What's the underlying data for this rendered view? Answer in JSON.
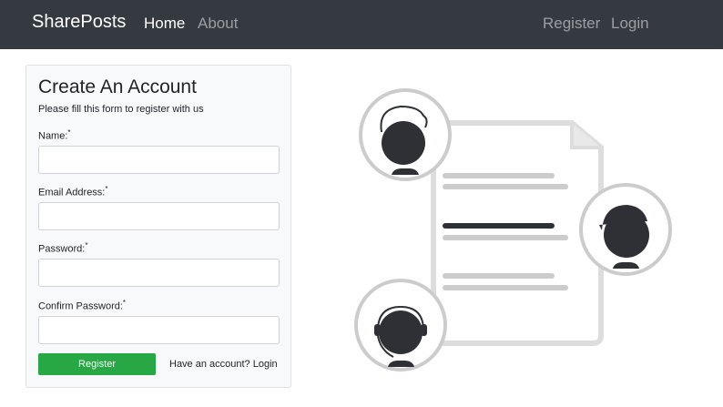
{
  "navbar": {
    "brand": "SharePosts",
    "links": [
      {
        "label": "Home",
        "active": true
      },
      {
        "label": "About",
        "active": false
      },
      {
        "label": "Register",
        "active": false
      },
      {
        "label": "Login",
        "active": false
      }
    ]
  },
  "form": {
    "title": "Create An Account",
    "subtitle": "Please fill this form to register with us",
    "fields": [
      {
        "label": "Name:",
        "required_mark": "*",
        "value": ""
      },
      {
        "label": "Email Address:",
        "required_mark": "*",
        "value": ""
      },
      {
        "label": "Password:",
        "required_mark": "*",
        "value": ""
      },
      {
        "label": "Confirm Password:",
        "required_mark": "*",
        "value": ""
      }
    ],
    "submit_label": "Register",
    "login_link": "Have an account? Login"
  },
  "colors": {
    "navbar_bg": "#343a40",
    "submit_bg": "#28a745",
    "illustration_dark": "#2f3036",
    "illustration_line": "#cccccc"
  },
  "illustration": {
    "icon": "document-collaboration-illustration"
  }
}
